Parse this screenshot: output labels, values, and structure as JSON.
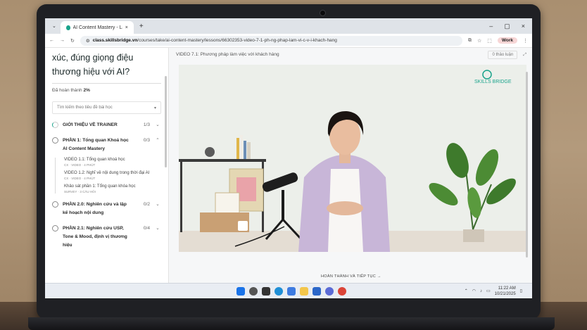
{
  "browser": {
    "tab_title": "AI Content Mastery - Làm ...",
    "url_host": "class.skillsbridge.vn",
    "url_path": "/courses/take/ai-content-mastery/lessons/66302353-video-7-1-ph-ng-phap-lam-vi-c-v-i-khach-hang",
    "profile_label": "Work"
  },
  "sidebar": {
    "course_title": "xúc, đúng giọng điệu thương hiệu với AI?",
    "progress_label": "Đã hoàn thành",
    "progress_value": "2%",
    "search_placeholder": "Tìm kiếm theo tiêu đề bài học",
    "sections": [
      {
        "title": "GIỚI THIỆU VỀ TRAINER",
        "count": "1/3"
      },
      {
        "title": "PHẦN 1: Tổng quan Khoá học AI Content Mastery",
        "count": "0/3"
      },
      {
        "title": "PHẦN 2.0: Nghiên cứu và lập kế hoạch nội dung",
        "count": "0/2"
      },
      {
        "title": "PHẦN 2.1: Nghiên cứu USP, Tone & Mood, định vị thương hiệu",
        "count": "0/4"
      }
    ],
    "lessons": [
      {
        "title": "VIDEO 1.1: Tổng quan khoá học",
        "meta": "CX · VIDEO · 4 PHÚT"
      },
      {
        "title": "VIDEO 1.2: Nghĩ về nội dung trong thời đại AI",
        "meta": "CX · VIDEO · 4 PHÚT"
      },
      {
        "title": "Khảo sát phần 1: Tổng quan khóa học",
        "meta": "SURVEY · 3 CÂU HỎI"
      }
    ]
  },
  "main": {
    "video_title": "VIDEO 7.1: Phương pháp làm việc với khách hàng",
    "notes_button": "0 thảo luận",
    "watermark": "SKILLS BRIDGE",
    "next_label": "HOÀN THÀNH VÀ TIẾP TỤC →"
  },
  "taskbar": {
    "time": "11:22 AM",
    "date": "10/21/2025"
  },
  "colors": {
    "accent": "#19a38b",
    "wall": "#ecefea",
    "jacket": "#c8b6d8",
    "plant": "#3d6b2f"
  }
}
